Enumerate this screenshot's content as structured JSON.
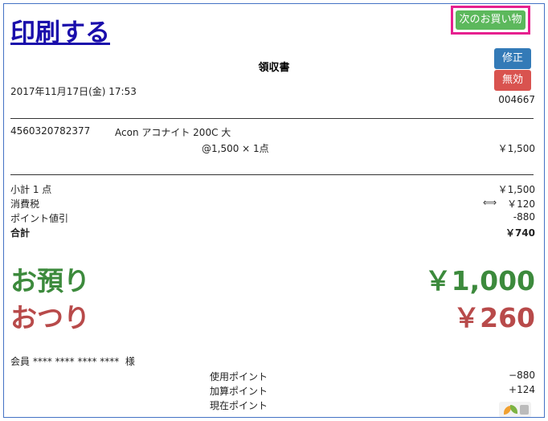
{
  "header": {
    "print_link": "印刷する",
    "next_button": "次のお買い物",
    "edit_button": "修正",
    "void_button": "無効"
  },
  "receipt": {
    "title": "領収書",
    "datetime": "2017年11月17日(金) 17:53",
    "receipt_no": "004667",
    "item": {
      "jan": "4560320782377",
      "name": "Acon アコナイト 200C 大",
      "unit_qty": "@1,500 × 1点",
      "amount": "￥1,500"
    },
    "subtotal_label": "小計 1 点",
    "subtotal_value": "￥1,500",
    "tax_label": "消費税",
    "tax_value": "￥120",
    "point_discount_label": "ポイント値引",
    "point_discount_value": "-880",
    "total_label": "合計",
    "total_value": "￥740",
    "deposit_label": "お預り",
    "deposit_value": "￥1,000",
    "change_label": "おつり",
    "change_value": "￥260",
    "member": "会員 **** **** **** ****  様",
    "points": [
      {
        "label": "使用ポイント",
        "value": "−880"
      },
      {
        "label": "加算ポイント",
        "value": "+124"
      },
      {
        "label": "現在ポイント",
        "value": ""
      }
    ]
  },
  "colors": {
    "green": "#3c8a3c",
    "red": "#b84a4a",
    "highlight": "#e6208f"
  }
}
